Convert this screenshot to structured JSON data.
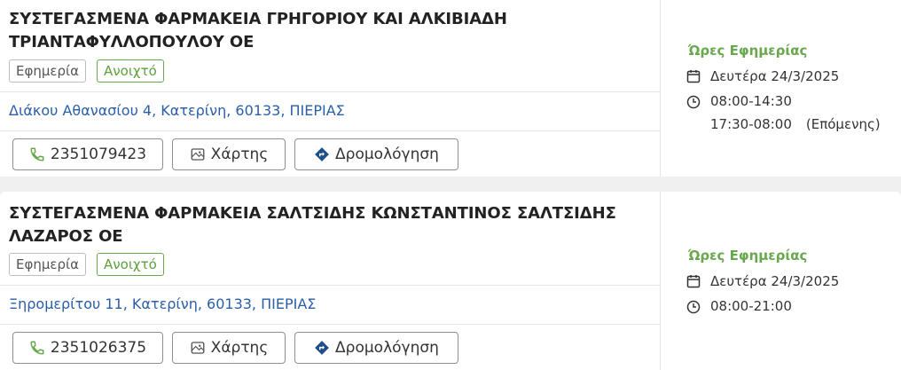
{
  "pharmacies": [
    {
      "title_line1": "ΣΥΣΤΕΓΑΣΜΕΝΑ ΦΑΡΜΑΚΕΙΑ ΓΡΗΓΟΡΙΟΥ ΚΑΙ ΑΛΚΙΒΙΑΔΗ",
      "title_line2": "ΤΡΙΑΝΤΑΦΥΛΛΟΠΟΥΛΟΥ ΟΕ",
      "badge_duty": "Εφημερία",
      "badge_open": "Ανοιχτό",
      "address": "Διάκου Αθανασίου 4, Κατερίνη, 60133, ΠΙΕΡΙΑΣ",
      "phone": "2351079423",
      "map_label": "Χάρτης",
      "route_label": "Δρομολόγηση",
      "hours_title": "Ώρες Εφημερίας",
      "date": "Δευτέρα 24/3/2025",
      "time1": "08:00-14:30",
      "time2": "17:30-08:00",
      "time2_note": "(Επόμενης)"
    },
    {
      "title_line1": "ΣΥΣΤΕΓΑΣΜΕΝΑ ΦΑΡΜΑΚΕΙΑ ΣΑΛΤΣΙΔΗΣ ΚΩΝΣΤΑΝΤΙΝΟΣ ΣΑΛΤΣΙΔΗΣ",
      "title_line2": "ΛΑΖΑΡΟΣ ΟΕ",
      "badge_duty": "Εφημερία",
      "badge_open": "Ανοιχτό",
      "address": "Ξηρομερίτου 11, Κατερίνη, 60133, ΠΙΕΡΙΑΣ",
      "phone": "2351026375",
      "map_label": "Χάρτης",
      "route_label": "Δρομολόγηση",
      "hours_title": "Ώρες Εφημερίας",
      "date": "Δευτέρα 24/3/2025",
      "time1": "08:00-21:00"
    }
  ],
  "icons": {
    "phone": "phone-icon",
    "map": "map-icon",
    "route": "directions-icon",
    "calendar": "calendar-icon",
    "clock": "clock-icon"
  },
  "colors": {
    "accent_green": "#6aa84f",
    "link_blue": "#2a5fa8",
    "route_icon_blue": "#1f4e8c"
  }
}
